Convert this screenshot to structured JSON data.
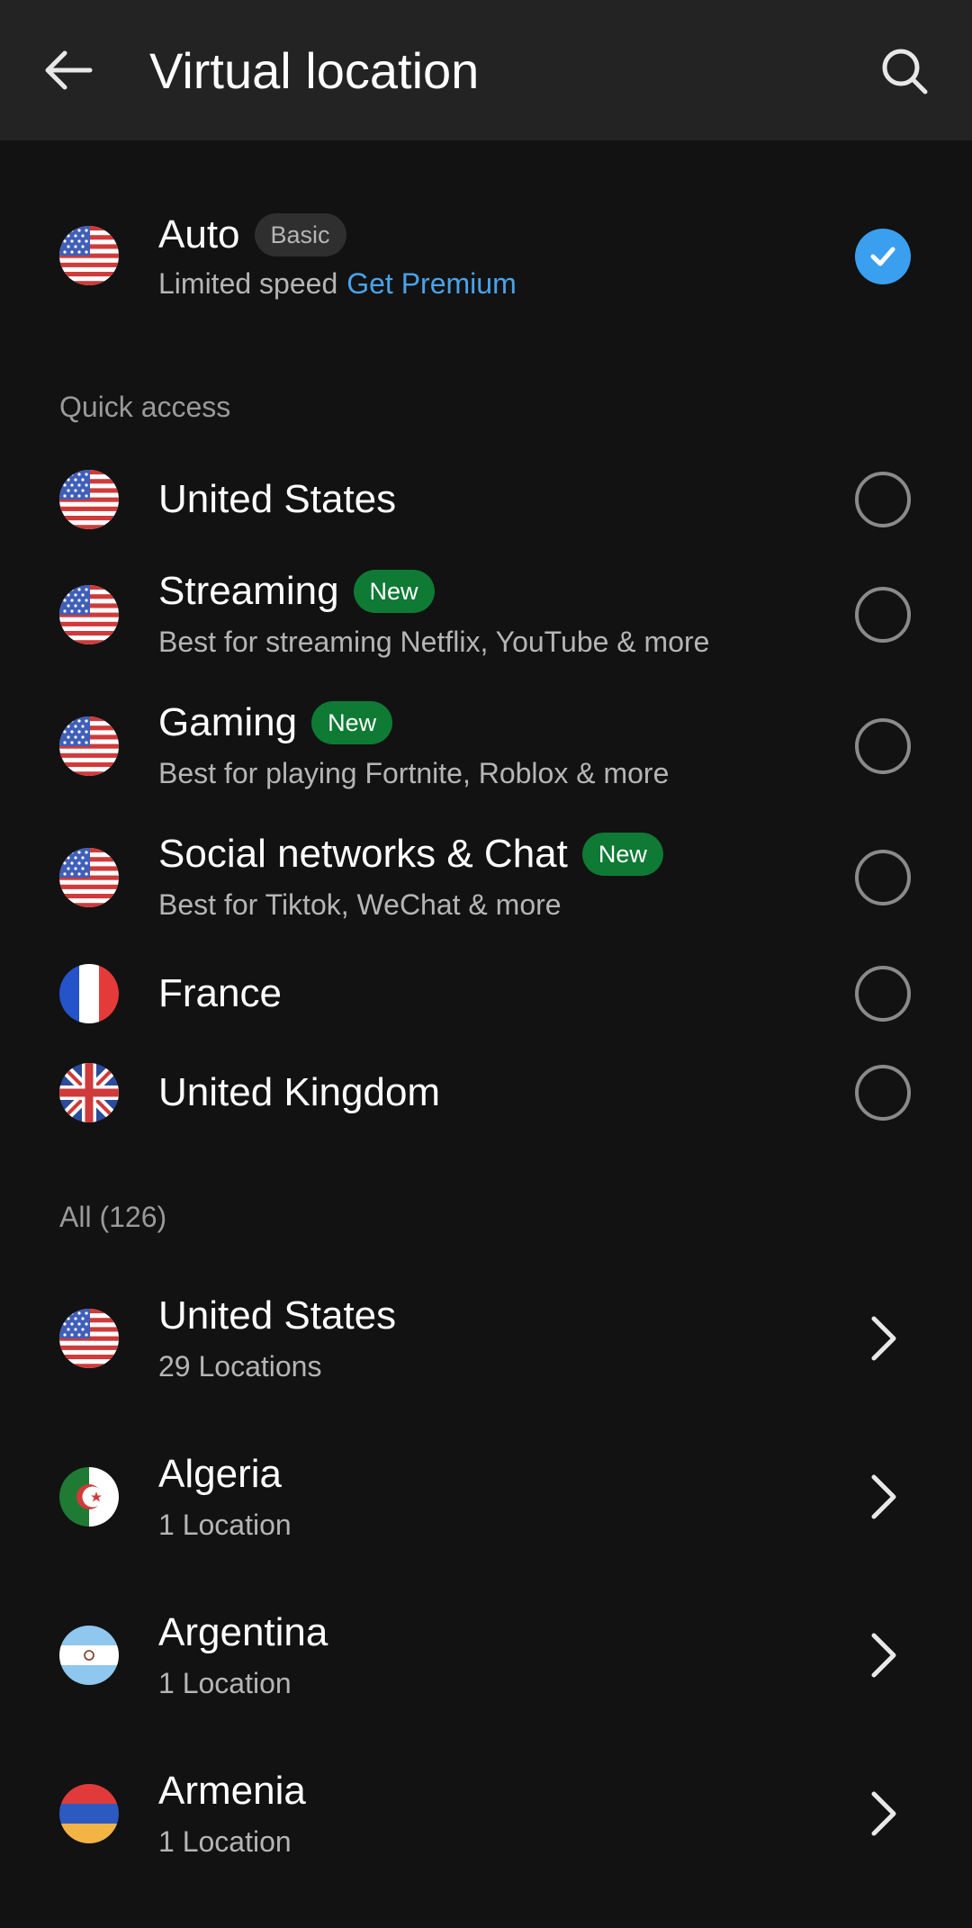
{
  "header": {
    "title": "Virtual location"
  },
  "auto": {
    "title": "Auto",
    "badge": "Basic",
    "subtitle": "Limited speed",
    "premium_link": "Get Premium",
    "selected": true
  },
  "quick_access": {
    "header": "Quick access",
    "items": [
      {
        "title": "United States",
        "subtitle": "",
        "badge": "",
        "flag": "us-flag"
      },
      {
        "title": "Streaming",
        "subtitle": "Best for streaming Netflix, YouTube & more",
        "badge": "New",
        "flag": "us-flag"
      },
      {
        "title": "Gaming",
        "subtitle": "Best for playing Fortnite, Roblox & more",
        "badge": "New",
        "flag": "us-flag"
      },
      {
        "title": "Social networks & Chat",
        "subtitle": "Best for Tiktok, WeChat & more",
        "badge": "New",
        "flag": "us-flag"
      },
      {
        "title": "France",
        "subtitle": "",
        "badge": "",
        "flag": "france-flag"
      },
      {
        "title": "United Kingdom",
        "subtitle": "",
        "badge": "",
        "flag": "uk-flag"
      }
    ]
  },
  "all": {
    "header": "All (126)",
    "items": [
      {
        "title": "United States",
        "subtitle": "29 Locations",
        "flag": "us-flag"
      },
      {
        "title": "Algeria",
        "subtitle": "1 Location",
        "flag": "algeria-flag"
      },
      {
        "title": "Argentina",
        "subtitle": "1 Location",
        "flag": "argentina-flag"
      },
      {
        "title": "Armenia",
        "subtitle": "1 Location",
        "flag": "armenia-flag"
      }
    ]
  },
  "colors": {
    "background": "#121212",
    "appbar": "#232323",
    "accent": "#3b9ff0",
    "link": "#4aa3ea",
    "new_badge": "#0e7a34"
  }
}
